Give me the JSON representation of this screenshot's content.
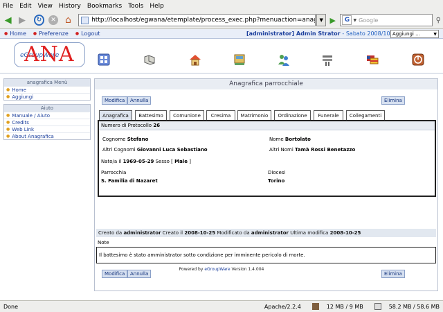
{
  "browser": {
    "menu": [
      "File",
      "Edit",
      "View",
      "History",
      "Bookmarks",
      "Tools",
      "Help"
    ],
    "url": "http://localhost/egwana/etemplate/process_exec.php?menuaction=anagrafica.uianagrafic",
    "search_placeholder": "Google"
  },
  "topbar": {
    "links": [
      "Home",
      "Preferenze",
      "Logout"
    ],
    "user": "[administrator] Admin Strator",
    "date": "- Sabato 2008/10/25",
    "select": "Aggiungi ..."
  },
  "logo": {
    "big": "ANA",
    "small": "eGroupWare"
  },
  "apps": [
    "home-icon",
    "folder-icon",
    "addressbook-icon",
    "filemanager-icon",
    "users-icon",
    "settings-icon",
    "language-icon",
    "logout-icon"
  ],
  "sidebar": {
    "menu_title": "anagrafica Menù",
    "menu_items": [
      "Home",
      "Aggiungi"
    ],
    "help_title": "Aiuto",
    "help_items": [
      "Manuale / Aiuto",
      "Credits",
      "Web Link",
      "About Anagrafica"
    ]
  },
  "main": {
    "title": "Anagrafica parrocchiale",
    "buttons": {
      "modify": "Modifica",
      "cancel": "Annulla",
      "delete": "Elimina"
    },
    "tabs": [
      "Anagrafica",
      "Battesimo",
      "Comunione",
      "Cresima",
      "Matrimonio",
      "Ordinazione",
      "Funerale",
      "Collegamenti"
    ],
    "protocol_label": "Numero di Protocollo",
    "protocol_value": "26",
    "cognome_label": "Cognome",
    "cognome_value": "Stefano",
    "nome_label": "Nome",
    "nome_value": "Bortolato",
    "altri_cognomi_label": "Altri Cognomi",
    "altri_cognomi_value": "Giovanni Luca Sebastiano",
    "altri_nomi_label": "Altri Nomi",
    "altri_nomi_value": "Tamà Rossi Benetazzo",
    "nato_label": "Nato/a il",
    "nato_value": "1969-05-29",
    "sesso_label": "Sesso [",
    "sesso_value": "Male",
    "sesso_end": "]",
    "parrocchia_label": "Parrocchia",
    "parrocchia_value": "S. Familia di Nazaret",
    "diocesi_label": "Diocesi",
    "diocesi_value": "Torino",
    "created_label": "Creato da",
    "created_by": "administrator",
    "created_mid": "Creato il",
    "created_on": "2008-10-25",
    "modified_label": "Modificato da",
    "modified_by": "administrator",
    "modified_mid": "Ultima modifica",
    "modified_on": "2008-10-25",
    "note_label": "Note",
    "note_text": "Il battesimo è stato amministrator sotto condizione per imminente pericolo di morte."
  },
  "footer": {
    "prefix": "Powered by",
    "brand": "eGroupWare",
    "version": "Version 1.4.004"
  },
  "status": {
    "left": "Done",
    "server": "Apache/2.2.4",
    "memory1": "12 MB / 9 MB",
    "memory2": "58.2 MB / 58.6 MB"
  }
}
